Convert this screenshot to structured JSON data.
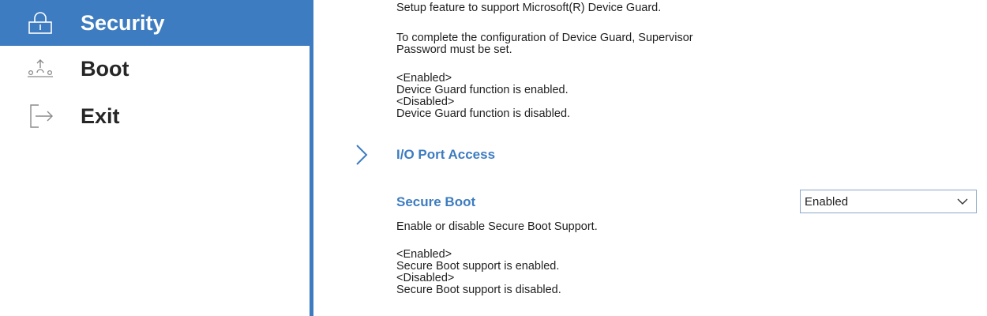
{
  "sidebar": {
    "items": [
      {
        "label": "Security",
        "icon": "lock-icon",
        "active": true
      },
      {
        "label": "Boot",
        "icon": "boot-icon",
        "active": false
      },
      {
        "label": "Exit",
        "icon": "exit-icon",
        "active": false
      }
    ]
  },
  "colors": {
    "accent": "#3d7cc0",
    "active_text": "#ffffff",
    "body_text": "#1f1f1f"
  },
  "main": {
    "device_guard": {
      "description": "Setup feature to support Microsoft(R) Device Guard.",
      "note": "To complete the configuration of Device Guard, Supervisor\nPassword must be set.",
      "options": "<Enabled>\nDevice Guard function is enabled.\n<Disabled>\nDevice Guard function is disabled."
    },
    "io_port_access": {
      "label": "I/O Port Access",
      "icon": "chevron-right-icon"
    },
    "secure_boot": {
      "label": "Secure Boot",
      "description": "Enable or disable Secure Boot Support.",
      "options": "<Enabled>\nSecure Boot support is enabled.\n<Disabled>\nSecure Boot support is disabled.",
      "select_value": "Enabled",
      "select_icon": "chevron-down-icon"
    }
  }
}
